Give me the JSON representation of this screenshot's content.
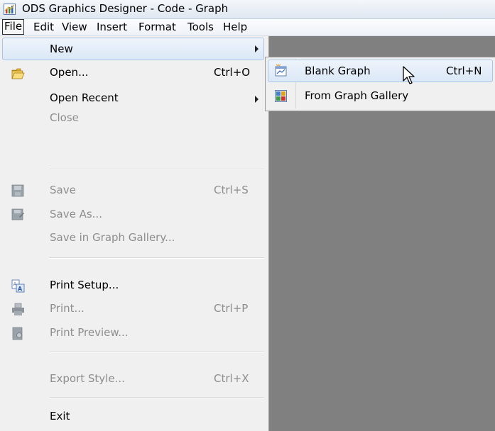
{
  "window": {
    "title": "ODS Graphics Designer - Code - Graph",
    "app_icon": "chart-app-icon"
  },
  "menubar": {
    "items": [
      {
        "label": "File",
        "active": true
      },
      {
        "label": "Edit"
      },
      {
        "label": "View"
      },
      {
        "label": "Insert"
      },
      {
        "label": "Format"
      },
      {
        "label": "Tools"
      },
      {
        "label": "Help"
      }
    ]
  },
  "file_menu": {
    "items": [
      {
        "label": "New",
        "has_submenu": true,
        "highlighted": true
      },
      {
        "label": "Open...",
        "shortcut": "Ctrl+O",
        "icon": "open-folder-icon"
      },
      {
        "label": "Open Recent",
        "has_submenu": true
      },
      {
        "label": "Close",
        "disabled": true
      },
      {
        "label": "Save",
        "shortcut": "Ctrl+S",
        "disabled": true,
        "icon": "save-disk-icon"
      },
      {
        "label": "Save As...",
        "disabled": true,
        "icon": "save-as-icon"
      },
      {
        "label": "Save in Graph Gallery...",
        "disabled": true
      },
      {
        "label": "Print Setup...",
        "icon": "print-setup-icon"
      },
      {
        "label": "Print...",
        "shortcut": "Ctrl+P",
        "disabled": true,
        "icon": "printer-icon"
      },
      {
        "label": "Print Preview...",
        "disabled": true,
        "icon": "print-preview-icon"
      },
      {
        "label": "Export Style...",
        "shortcut": "Ctrl+X",
        "disabled": true
      },
      {
        "label": "Exit"
      }
    ]
  },
  "new_submenu": {
    "items": [
      {
        "label": "Blank Graph",
        "shortcut": "Ctrl+N",
        "highlighted": true,
        "icon": "blank-graph-icon"
      },
      {
        "label": "From Graph Gallery",
        "icon": "graph-gallery-icon"
      }
    ]
  },
  "colors": {
    "menu_bg": "#f0f0f0",
    "highlight_bg": "#dbe8f7",
    "highlight_border": "#aac4e6",
    "disabled_text": "#8d8d8d",
    "client_bg": "#808080"
  }
}
